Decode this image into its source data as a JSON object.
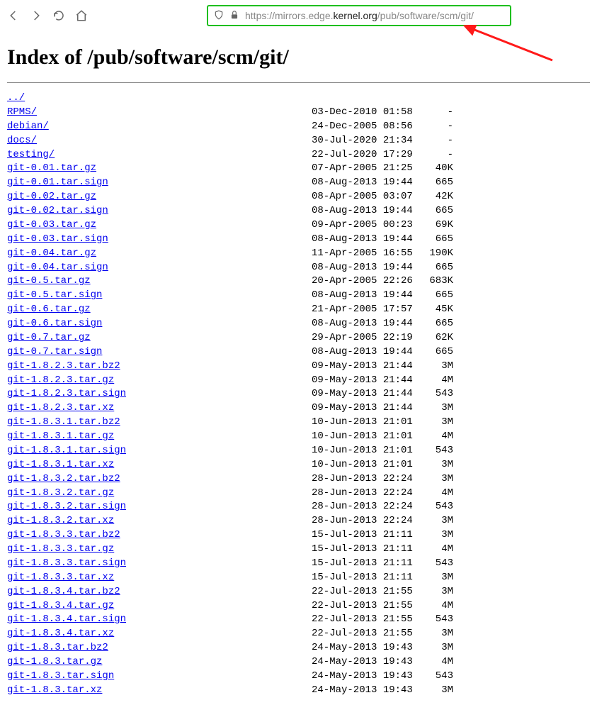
{
  "url": {
    "prefix": "https://mirrors.edge.",
    "domain": "kernel.org",
    "path": "/pub/software/scm/git/"
  },
  "heading": "Index of /pub/software/scm/git/",
  "listing": [
    {
      "name": "../",
      "date": "",
      "size": ""
    },
    {
      "name": "RPMS/",
      "date": "03-Dec-2010 01:58",
      "size": "-"
    },
    {
      "name": "debian/",
      "date": "24-Dec-2005 08:56",
      "size": "-"
    },
    {
      "name": "docs/",
      "date": "30-Jul-2020 21:34",
      "size": "-"
    },
    {
      "name": "testing/",
      "date": "22-Jul-2020 17:29",
      "size": "-"
    },
    {
      "name": "git-0.01.tar.gz",
      "date": "07-Apr-2005 21:25",
      "size": "40K"
    },
    {
      "name": "git-0.01.tar.sign",
      "date": "08-Aug-2013 19:44",
      "size": "665"
    },
    {
      "name": "git-0.02.tar.gz",
      "date": "08-Apr-2005 03:07",
      "size": "42K"
    },
    {
      "name": "git-0.02.tar.sign",
      "date": "08-Aug-2013 19:44",
      "size": "665"
    },
    {
      "name": "git-0.03.tar.gz",
      "date": "09-Apr-2005 00:23",
      "size": "69K"
    },
    {
      "name": "git-0.03.tar.sign",
      "date": "08-Aug-2013 19:44",
      "size": "665"
    },
    {
      "name": "git-0.04.tar.gz",
      "date": "11-Apr-2005 16:55",
      "size": "190K"
    },
    {
      "name": "git-0.04.tar.sign",
      "date": "08-Aug-2013 19:44",
      "size": "665"
    },
    {
      "name": "git-0.5.tar.gz",
      "date": "20-Apr-2005 22:26",
      "size": "683K"
    },
    {
      "name": "git-0.5.tar.sign",
      "date": "08-Aug-2013 19:44",
      "size": "665"
    },
    {
      "name": "git-0.6.tar.gz",
      "date": "21-Apr-2005 17:57",
      "size": "45K"
    },
    {
      "name": "git-0.6.tar.sign",
      "date": "08-Aug-2013 19:44",
      "size": "665"
    },
    {
      "name": "git-0.7.tar.gz",
      "date": "29-Apr-2005 22:19",
      "size": "62K"
    },
    {
      "name": "git-0.7.tar.sign",
      "date": "08-Aug-2013 19:44",
      "size": "665"
    },
    {
      "name": "git-1.8.2.3.tar.bz2",
      "date": "09-May-2013 21:44",
      "size": "3M"
    },
    {
      "name": "git-1.8.2.3.tar.gz",
      "date": "09-May-2013 21:44",
      "size": "4M"
    },
    {
      "name": "git-1.8.2.3.tar.sign",
      "date": "09-May-2013 21:44",
      "size": "543"
    },
    {
      "name": "git-1.8.2.3.tar.xz",
      "date": "09-May-2013 21:44",
      "size": "3M"
    },
    {
      "name": "git-1.8.3.1.tar.bz2",
      "date": "10-Jun-2013 21:01",
      "size": "3M"
    },
    {
      "name": "git-1.8.3.1.tar.gz",
      "date": "10-Jun-2013 21:01",
      "size": "4M"
    },
    {
      "name": "git-1.8.3.1.tar.sign",
      "date": "10-Jun-2013 21:01",
      "size": "543"
    },
    {
      "name": "git-1.8.3.1.tar.xz",
      "date": "10-Jun-2013 21:01",
      "size": "3M"
    },
    {
      "name": "git-1.8.3.2.tar.bz2",
      "date": "28-Jun-2013 22:24",
      "size": "3M"
    },
    {
      "name": "git-1.8.3.2.tar.gz",
      "date": "28-Jun-2013 22:24",
      "size": "4M"
    },
    {
      "name": "git-1.8.3.2.tar.sign",
      "date": "28-Jun-2013 22:24",
      "size": "543"
    },
    {
      "name": "git-1.8.3.2.tar.xz",
      "date": "28-Jun-2013 22:24",
      "size": "3M"
    },
    {
      "name": "git-1.8.3.3.tar.bz2",
      "date": "15-Jul-2013 21:11",
      "size": "3M"
    },
    {
      "name": "git-1.8.3.3.tar.gz",
      "date": "15-Jul-2013 21:11",
      "size": "4M"
    },
    {
      "name": "git-1.8.3.3.tar.sign",
      "date": "15-Jul-2013 21:11",
      "size": "543"
    },
    {
      "name": "git-1.8.3.3.tar.xz",
      "date": "15-Jul-2013 21:11",
      "size": "3M"
    },
    {
      "name": "git-1.8.3.4.tar.bz2",
      "date": "22-Jul-2013 21:55",
      "size": "3M"
    },
    {
      "name": "git-1.8.3.4.tar.gz",
      "date": "22-Jul-2013 21:55",
      "size": "4M"
    },
    {
      "name": "git-1.8.3.4.tar.sign",
      "date": "22-Jul-2013 21:55",
      "size": "543"
    },
    {
      "name": "git-1.8.3.4.tar.xz",
      "date": "22-Jul-2013 21:55",
      "size": "3M"
    },
    {
      "name": "git-1.8.3.tar.bz2",
      "date": "24-May-2013 19:43",
      "size": "3M"
    },
    {
      "name": "git-1.8.3.tar.gz",
      "date": "24-May-2013 19:43",
      "size": "4M"
    },
    {
      "name": "git-1.8.3.tar.sign",
      "date": "24-May-2013 19:43",
      "size": "543"
    },
    {
      "name": "git-1.8.3.tar.xz",
      "date": "24-May-2013 19:43",
      "size": "3M"
    }
  ]
}
